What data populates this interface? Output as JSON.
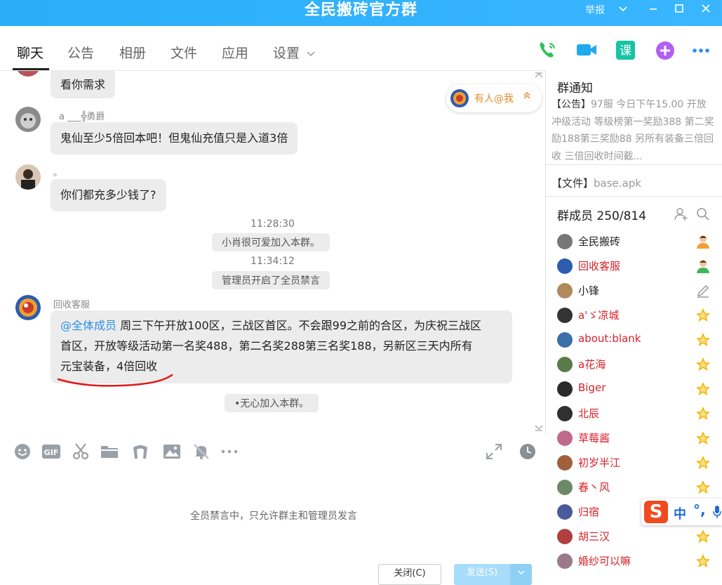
{
  "window": {
    "title": "全民搬砖官方群",
    "report_label": "举报",
    "controls": [
      "chevron-down",
      "minimize",
      "maximize",
      "close"
    ]
  },
  "tabs": [
    {
      "label": "聊天",
      "active": true
    },
    {
      "label": "公告",
      "active": false
    },
    {
      "label": "相册",
      "active": false
    },
    {
      "label": "文件",
      "active": false
    },
    {
      "label": "应用",
      "active": false
    },
    {
      "label": "设置",
      "active": false
    }
  ],
  "actions": {
    "lesson_label": "课"
  },
  "messages": [
    {
      "name": "",
      "text": "看你需求"
    },
    {
      "name": "a ___╬勇爵",
      "text": "鬼仙至少5倍回本吧！但鬼仙充值只是入道3倍"
    },
    {
      "name": "。",
      "text": "你们都充多少钱了?"
    }
  ],
  "system_events": [
    {
      "time": "11:28:30",
      "text": "小肖很可爱加入本群。"
    },
    {
      "time": "11:34:12",
      "text": "管理员开启了全员禁言"
    }
  ],
  "announcement_msg": {
    "name": "回收客服",
    "mention": "@全体成员",
    "line1": " 周三下午开放100区，三战区首区。不会跟99之前的合区，为庆祝三战区",
    "line2": "首区，开放等级活动第一名奖488，第二名奖288第三名奖188，另新区三天内所有",
    "line3": "元宝装备，4倍回收"
  },
  "join_notice": "•无心加入本群。",
  "at_me": {
    "label": "有人@我",
    "chevron": "≈"
  },
  "compose": {
    "hint": "全员禁言中，只允许群主和管理员发言",
    "close_label": "关闭(C)",
    "send_label": "发送(S)"
  },
  "sidebar": {
    "notice_title": "群通知",
    "notice_tag": "【公告】",
    "notice_text": "97服 今日下午15.00 开放冲级活动 等级榜第一奖励388 第二奖励188第三奖励88 另所有装备三倍回收 三倍回收时间截...",
    "file_tag": "【文件】",
    "file_name": "base.apk",
    "members_title": "群成员 250/814",
    "members": [
      {
        "name": "全民搬砖",
        "role": "owner",
        "color": "plain"
      },
      {
        "name": "回收客服",
        "role": "admin",
        "color": "red"
      },
      {
        "name": "小锋",
        "role": "edit",
        "color": "plain"
      },
      {
        "name": "a'ゞ凉城",
        "role": "star",
        "color": "red"
      },
      {
        "name": "about:blank",
        "role": "star",
        "color": "red"
      },
      {
        "name": "a花海",
        "role": "star",
        "color": "red"
      },
      {
        "name": "Biger",
        "role": "star",
        "color": "red"
      },
      {
        "name": "北辰",
        "role": "star",
        "color": "red"
      },
      {
        "name": "草莓酱",
        "role": "star",
        "color": "red"
      },
      {
        "name": "初岁半江",
        "role": "star",
        "color": "red"
      },
      {
        "name": "春丶风",
        "role": "star",
        "color": "red"
      },
      {
        "name": "归宿",
        "role": "star",
        "color": "red"
      },
      {
        "name": "胡三汉",
        "role": "star",
        "color": "red"
      },
      {
        "name": "婚纱可以嘛",
        "role": "star",
        "color": "red"
      }
    ]
  },
  "ime": {
    "logo": "S",
    "mode": "中",
    "punct": "°,"
  },
  "colors": {
    "accent": "#2aaef8",
    "red": "#d6212a",
    "orange": "#e88b2b",
    "star": "#f5b400"
  }
}
